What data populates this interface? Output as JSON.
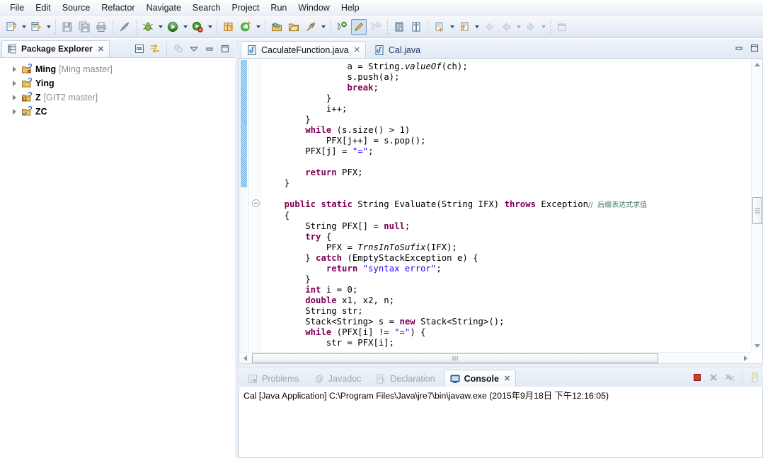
{
  "menubar": {
    "items": [
      {
        "label": "File"
      },
      {
        "label": "Edit"
      },
      {
        "label": "Source"
      },
      {
        "label": "Refactor"
      },
      {
        "label": "Navigate"
      },
      {
        "label": "Search"
      },
      {
        "label": "Project"
      },
      {
        "label": "Run"
      },
      {
        "label": "Window"
      },
      {
        "label": "Help"
      }
    ]
  },
  "toolbar": {
    "buttons": [
      {
        "name": "new-wizard-icon",
        "title": "New"
      },
      {
        "name": "new-java-class-icon",
        "title": "New Java Class"
      },
      {
        "name": "save-icon",
        "title": "Save"
      },
      {
        "name": "save-all-icon",
        "title": "Save All"
      },
      {
        "name": "print-icon",
        "title": "Print"
      },
      {
        "name": "toggle-mark-occurrences-icon",
        "title": "Toggle Mark Occurrences"
      },
      {
        "name": "debug-icon",
        "title": "Debug"
      },
      {
        "name": "run-icon",
        "title": "Run"
      },
      {
        "name": "run-external-tools-icon",
        "title": "External Tools"
      },
      {
        "name": "new-java-project-icon",
        "title": "New Java Project"
      },
      {
        "name": "new-annotation-icon",
        "title": "New Annotation"
      },
      {
        "name": "open-type-icon",
        "title": "Open Type"
      },
      {
        "name": "open-task-icon",
        "title": "Open Task"
      },
      {
        "name": "search-icon",
        "title": "Search"
      },
      {
        "name": "next-annotation-icon",
        "title": "Next Annotation"
      },
      {
        "name": "pencil-icon",
        "title": "Edit"
      },
      {
        "name": "previous-annotation-icon",
        "title": "Previous Annotation"
      },
      {
        "name": "last-edit-location-icon",
        "title": "Last Edit Location"
      },
      {
        "name": "restore-icon",
        "title": "Restore"
      },
      {
        "name": "step-icon",
        "title": "Step"
      },
      {
        "name": "back-icon",
        "title": "Back"
      },
      {
        "name": "forward-icon",
        "title": "Forward"
      },
      {
        "name": "open-perspective-icon",
        "title": "Open Perspective"
      }
    ]
  },
  "package_explorer": {
    "tab_label": "Package Explorer",
    "tab_close_glyph": "✕",
    "tools": [
      {
        "name": "collapse-all-icon"
      },
      {
        "name": "link-with-editor-icon"
      },
      {
        "name": "view-menu-filter-icon"
      },
      {
        "name": "view-menu-icon"
      },
      {
        "name": "minimize-icon"
      },
      {
        "name": "maximize-icon"
      }
    ],
    "tree": [
      {
        "name": "Ming",
        "meta": "[Ming master]",
        "icon": "java-project-icon"
      },
      {
        "name": "Ying",
        "meta": "",
        "icon": "java-project-icon"
      },
      {
        "name": "Z",
        "meta": "[GIT2 master]",
        "icon": "java-project-icon"
      },
      {
        "name": "ZC",
        "meta": "",
        "icon": "java-project-icon"
      }
    ]
  },
  "editor": {
    "tabs": [
      {
        "label": "CaculateFunction.java",
        "active": true,
        "close_glyph": "✕",
        "icon": "java-file-icon"
      },
      {
        "label": "Cal.java",
        "active": false,
        "close_glyph": "",
        "icon": "java-file-icon"
      }
    ],
    "window_buttons": [
      {
        "name": "minimize-icon"
      },
      {
        "name": "maximize-icon"
      }
    ],
    "code_lines": [
      {
        "indent": 0,
        "tokens": [
          {
            "t": "                a = String.",
            "c": ""
          },
          {
            "t": "valueOf",
            "c": "m"
          },
          {
            "t": "(ch);",
            "c": ""
          }
        ]
      },
      {
        "indent": 0,
        "tokens": [
          {
            "t": "                s.push(a);",
            "c": ""
          }
        ]
      },
      {
        "indent": 0,
        "tokens": [
          {
            "t": "                ",
            "c": ""
          },
          {
            "t": "break",
            "c": "k"
          },
          {
            "t": ";",
            "c": ""
          }
        ]
      },
      {
        "indent": 0,
        "tokens": [
          {
            "t": "            }",
            "c": ""
          }
        ]
      },
      {
        "indent": 0,
        "tokens": [
          {
            "t": "            i++;",
            "c": ""
          }
        ]
      },
      {
        "indent": 0,
        "tokens": [
          {
            "t": "        }",
            "c": ""
          }
        ]
      },
      {
        "indent": 0,
        "tokens": [
          {
            "t": "        ",
            "c": ""
          },
          {
            "t": "while",
            "c": "k"
          },
          {
            "t": " (s.size() > 1)",
            "c": ""
          }
        ]
      },
      {
        "indent": 0,
        "tokens": [
          {
            "t": "            PFX[j++] = s.pop();",
            "c": ""
          }
        ]
      },
      {
        "indent": 0,
        "tokens": [
          {
            "t": "        PFX[j] = ",
            "c": ""
          },
          {
            "t": "\"=\"",
            "c": "s"
          },
          {
            "t": ";",
            "c": ""
          }
        ]
      },
      {
        "indent": 0,
        "tokens": [
          {
            "t": "",
            "c": ""
          }
        ]
      },
      {
        "indent": 0,
        "tokens": [
          {
            "t": "        ",
            "c": ""
          },
          {
            "t": "return",
            "c": "k"
          },
          {
            "t": " PFX;",
            "c": ""
          }
        ]
      },
      {
        "indent": 0,
        "tokens": [
          {
            "t": "    }",
            "c": ""
          }
        ]
      },
      {
        "indent": 0,
        "tokens": [
          {
            "t": "",
            "c": ""
          }
        ]
      },
      {
        "indent": 0,
        "tokens": [
          {
            "t": "    ",
            "c": ""
          },
          {
            "t": "public static",
            "c": "k"
          },
          {
            "t": " String Evaluate(String IFX) ",
            "c": ""
          },
          {
            "t": "throws",
            "c": "k"
          },
          {
            "t": " Exception",
            "c": ""
          },
          {
            "t": "//  后缀表达式求值",
            "c": "cm"
          }
        ]
      },
      {
        "indent": 0,
        "tokens": [
          {
            "t": "    {",
            "c": ""
          }
        ]
      },
      {
        "indent": 0,
        "tokens": [
          {
            "t": "        String PFX[] = ",
            "c": ""
          },
          {
            "t": "null",
            "c": "k"
          },
          {
            "t": ";",
            "c": ""
          }
        ]
      },
      {
        "indent": 0,
        "tokens": [
          {
            "t": "        ",
            "c": ""
          },
          {
            "t": "try",
            "c": "k"
          },
          {
            "t": " {",
            "c": ""
          }
        ]
      },
      {
        "indent": 0,
        "tokens": [
          {
            "t": "            PFX = ",
            "c": ""
          },
          {
            "t": "TrnsInToSufix",
            "c": "m"
          },
          {
            "t": "(IFX);",
            "c": ""
          }
        ]
      },
      {
        "indent": 0,
        "tokens": [
          {
            "t": "        } ",
            "c": ""
          },
          {
            "t": "catch",
            "c": "k"
          },
          {
            "t": " (EmptyStackException e) {",
            "c": ""
          }
        ]
      },
      {
        "indent": 0,
        "tokens": [
          {
            "t": "            ",
            "c": ""
          },
          {
            "t": "return",
            "c": "k"
          },
          {
            "t": " ",
            "c": ""
          },
          {
            "t": "\"syntax error\"",
            "c": "s"
          },
          {
            "t": ";",
            "c": ""
          }
        ]
      },
      {
        "indent": 0,
        "tokens": [
          {
            "t": "        }",
            "c": ""
          }
        ]
      },
      {
        "indent": 0,
        "tokens": [
          {
            "t": "        ",
            "c": ""
          },
          {
            "t": "int",
            "c": "k"
          },
          {
            "t": " i = 0;",
            "c": ""
          }
        ]
      },
      {
        "indent": 0,
        "tokens": [
          {
            "t": "        ",
            "c": ""
          },
          {
            "t": "double",
            "c": "k"
          },
          {
            "t": " x1, x2, n;",
            "c": ""
          }
        ]
      },
      {
        "indent": 0,
        "tokens": [
          {
            "t": "        String str;",
            "c": ""
          }
        ]
      },
      {
        "indent": 0,
        "tokens": [
          {
            "t": "        Stack<String> s = ",
            "c": ""
          },
          {
            "t": "new",
            "c": "k"
          },
          {
            "t": " Stack<String>();",
            "c": ""
          }
        ]
      },
      {
        "indent": 0,
        "tokens": [
          {
            "t": "        ",
            "c": ""
          },
          {
            "t": "while",
            "c": "k"
          },
          {
            "t": " (PFX[i] != ",
            "c": ""
          },
          {
            "t": "\"=\"",
            "c": "s"
          },
          {
            "t": ") {",
            "c": ""
          }
        ]
      },
      {
        "indent": 0,
        "tokens": [
          {
            "t": "            str = PFX[i];",
            "c": ""
          }
        ]
      }
    ]
  },
  "console": {
    "tabs": [
      {
        "label": "Problems",
        "active": false,
        "icon": "problems-icon",
        "close_glyph": ""
      },
      {
        "label": "Javadoc",
        "active": false,
        "icon": "javadoc-icon",
        "close_glyph": ""
      },
      {
        "label": "Declaration",
        "active": false,
        "icon": "declaration-icon",
        "close_glyph": ""
      },
      {
        "label": "Console",
        "active": true,
        "icon": "console-icon",
        "close_glyph": "✕"
      }
    ],
    "tools": [
      {
        "name": "terminate-icon"
      },
      {
        "name": "remove-launch-icon"
      },
      {
        "name": "remove-all-terminated-icon"
      },
      {
        "name": "console-view-menu-icon"
      }
    ],
    "launch_line": "Cal [Java Application] C:\\Program Files\\Java\\jre7\\bin\\javaw.exe (2015年9月18日 下午12:16:05)"
  },
  "colors": {
    "keyword": "#7f0055",
    "string": "#2a00ff",
    "comment": "#3f7f5f",
    "tab_active_bg": "#ffffff",
    "chrome": "#e2eaf4",
    "annotation_ruler": "#58a8e0"
  }
}
